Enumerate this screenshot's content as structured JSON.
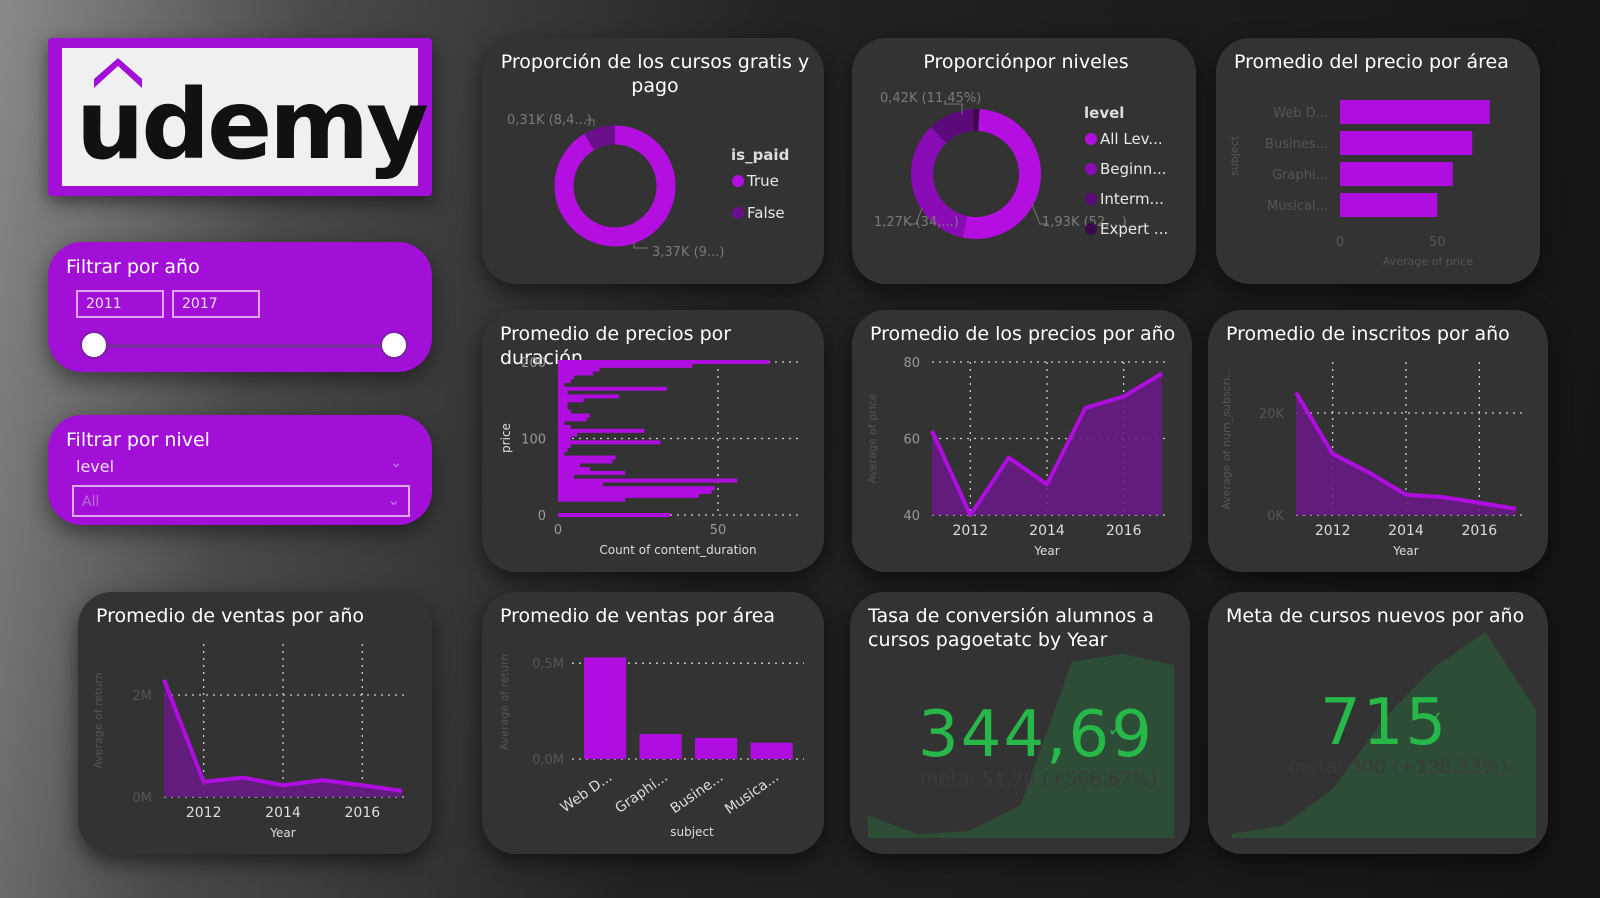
{
  "logo": {
    "text": "udemy"
  },
  "filters": {
    "year": {
      "title": "Filtrar por año",
      "from": "2011",
      "to": "2017"
    },
    "level": {
      "title": "Filtrar por nivel",
      "field": "level",
      "selected": "All"
    }
  },
  "cards": {
    "paid_ratio": {
      "title": "Proporción de los cursos gratis y pago",
      "legend_title": "is_paid",
      "chart_data": {
        "type": "pie",
        "donut": true,
        "title": "Proporción de los cursos gratis y pago",
        "labels": [
          "True",
          "False"
        ],
        "values": [
          3370,
          310
        ],
        "data_labels": [
          "3,37K (9...)",
          "0,31K (8,4...)"
        ],
        "colors": [
          "#b40fe0",
          "#6c0f8a"
        ]
      }
    },
    "level_ratio": {
      "title": "Proporciónpor niveles",
      "legend_title": "level",
      "chart_data": {
        "type": "pie",
        "donut": true,
        "title": "Proporciónpor niveles",
        "labels": [
          "All Lev...",
          "Beginn...",
          "Interm...",
          "Expert ..."
        ],
        "values": [
          1930,
          1270,
          420,
          58
        ],
        "data_labels": [
          "1,93K (52,...)",
          "1,27K (34,...)",
          "0,42K (11,45%)",
          ""
        ],
        "colors": [
          "#b40fe0",
          "#8a0cb6",
          "#5c0a7a",
          "#3a0a4a"
        ]
      }
    },
    "price_area": {
      "title": "Promedio del precio por área",
      "chart_data": {
        "type": "bar",
        "orientation": "horizontal",
        "title": "Promedio del precio por área",
        "categories": [
          "Web D...",
          "Busines...",
          "Graphi...",
          "Musical..."
        ],
        "values": [
          77,
          68,
          58,
          50
        ],
        "xlabel": "Average of price",
        "ylabel": "subject",
        "xlim": [
          0,
          90
        ],
        "xticks": [
          "0",
          "50"
        ]
      }
    },
    "price_duration": {
      "title": "Promedio de precios por duración",
      "chart_data": {
        "type": "bar",
        "orientation": "horizontal",
        "title": "Promedio de precios por duración",
        "x_label": "Count of content_duration",
        "y_label": "price",
        "ylim": [
          0,
          200
        ],
        "xlim": [
          0,
          75
        ],
        "yticks": [
          "0",
          "100",
          "200"
        ],
        "xticks": [
          "0",
          "50"
        ],
        "series": [
          {
            "y": [
              200,
              195,
              190,
              185,
              180,
              175,
              170,
              165,
              160,
              155,
              150,
              145,
              140,
              135,
              130,
              125,
              120,
              115,
              110,
              105,
              100,
              95,
              90,
              85,
              80,
              75,
              70,
              65,
              60,
              55,
              50,
              45,
              40,
              35,
              30,
              25,
              20,
              0
            ],
            "values": [
              66,
              42,
              13,
              11,
              5,
              4,
              2,
              34,
              3,
              19,
              8,
              3,
              3,
              4,
              10,
              9,
              2,
              4,
              27,
              6,
              4,
              32,
              4,
              3,
              2,
              18,
              17,
              7,
              10,
              21,
              5,
              56,
              14,
              49,
              48,
              44,
              21,
              35
            ]
          }
        ]
      }
    },
    "price_year": {
      "title": "Promedio de los precios por año",
      "chart_data": {
        "type": "area",
        "title": "Promedio de los precios por año",
        "x": [
          2011,
          2012,
          2013,
          2014,
          2015,
          2016,
          2017
        ],
        "values": [
          62,
          40,
          55,
          48,
          68,
          71,
          77
        ],
        "xlabel": "Year",
        "ylabel": "Average of price",
        "ylim": [
          40,
          80
        ],
        "yticks": [
          "40",
          "60",
          "80"
        ],
        "xticks": [
          "2012",
          "2014",
          "2016"
        ]
      }
    },
    "subscribers_year": {
      "title": "Promedio de inscritos por año",
      "chart_data": {
        "type": "area",
        "title": "Promedio de inscritos por año",
        "x": [
          2011,
          2012,
          2013,
          2014,
          2015,
          2016,
          2017
        ],
        "values": [
          24000,
          12000,
          8300,
          4000,
          3500,
          2400,
          1200
        ],
        "xlabel": "Year",
        "ylabel": "Average of num_subscri...",
        "ylim": [
          0,
          30000
        ],
        "yticks": [
          "0K",
          "20K"
        ],
        "xticks": [
          "2012",
          "2014",
          "2016"
        ]
      }
    },
    "sales_year": {
      "title": "Promedio de ventas por año",
      "chart_data": {
        "type": "area",
        "title": "Promedio de ventas por año",
        "x": [
          2011,
          2012,
          2013,
          2014,
          2015,
          2016,
          2017
        ],
        "values": [
          2300000,
          300000,
          380000,
          230000,
          330000,
          230000,
          120000
        ],
        "xlabel": "Year",
        "ylabel": "Average of return",
        "ylim": [
          0,
          3000000
        ],
        "yticks": [
          "0M",
          "2M"
        ],
        "xticks": [
          "2012",
          "2014",
          "2016"
        ]
      }
    },
    "sales_area": {
      "title": "Promedio de ventas por área",
      "chart_data": {
        "type": "bar",
        "title": "Promedio de ventas por área",
        "categories": [
          "Web D...",
          "Graphi...",
          "Busine...",
          "Musica..."
        ],
        "values": [
          0.53,
          0.13,
          0.11,
          0.085
        ],
        "xlabel": "subject",
        "ylabel": "Average of return",
        "ylim": [
          0,
          0.6
        ],
        "yticks": [
          "0,0M",
          "0,5M"
        ]
      }
    },
    "conversion": {
      "title": "Tasa de conversión alumnos a\ncursos pagoetatc by Year",
      "value": "344,69",
      "check": "✓",
      "goal": "meta: 51,70 (+566.67%)",
      "trend": [
        0.12,
        0.02,
        0.04,
        0.18,
        0.96,
        1.0,
        0.94
      ]
    },
    "new_courses": {
      "title": "Meta de cursos nuevos por año",
      "value": "715",
      "check": "✓",
      "goal": "meta: 300 (+138.33%)",
      "trend": [
        0.02,
        0.06,
        0.24,
        0.58,
        0.83,
        1.0,
        0.62
      ]
    }
  },
  "colors": {
    "accent": "#a20fd6",
    "bar": "#b00ee0",
    "area": "#6b1a8a",
    "kpi": "#27b84a",
    "kpi_area": "#2e4d36"
  }
}
